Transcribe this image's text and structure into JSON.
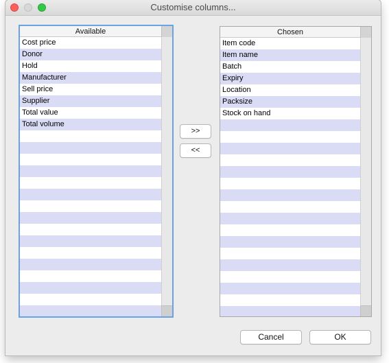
{
  "window": {
    "title": "Customise columns..."
  },
  "available": {
    "header": "Available",
    "items": [
      "Cost price",
      "Donor",
      "Hold",
      "Manufacturer",
      "Sell price",
      "Supplier",
      "Total value",
      "Total volume"
    ]
  },
  "chosen": {
    "header": "Chosen",
    "items": [
      "Item code",
      "Item name",
      "Batch",
      "Expiry",
      "Location",
      "Packsize",
      "Stock on hand"
    ]
  },
  "buttons": {
    "add": ">>",
    "remove": "<<",
    "cancel": "Cancel",
    "ok": "OK"
  },
  "colors": {
    "row_alt": "#dadcf6",
    "focus_ring": "#6aa1e7"
  }
}
